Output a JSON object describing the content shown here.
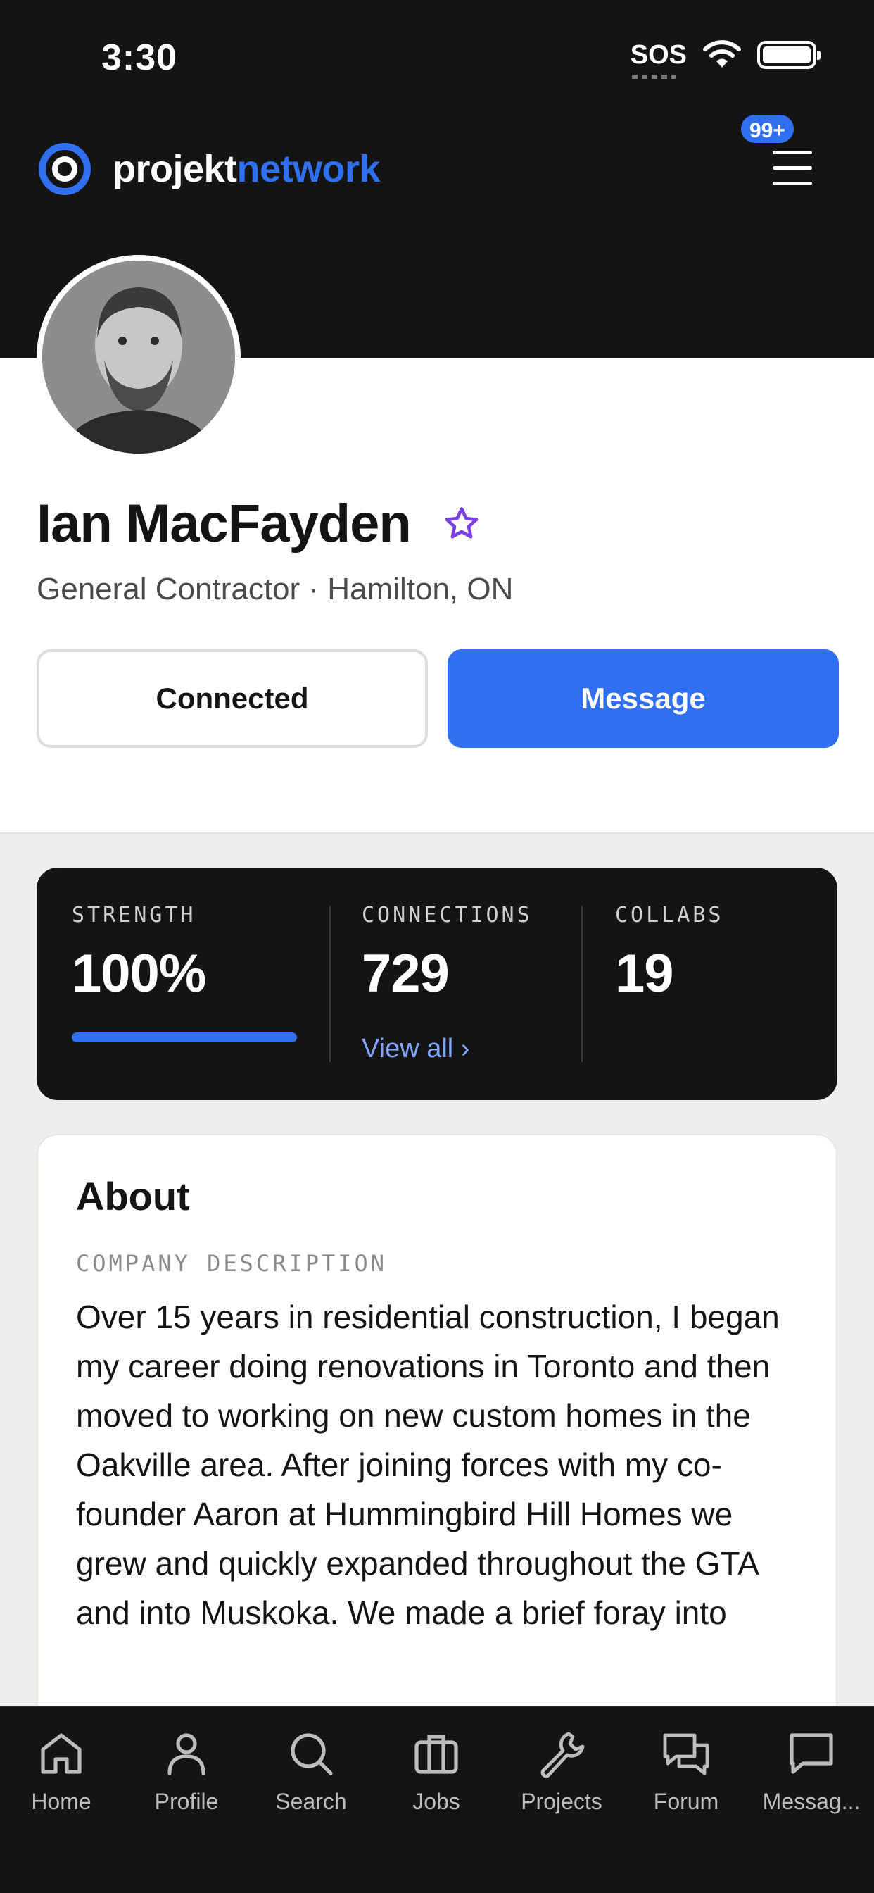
{
  "status_bar": {
    "time": "3:30",
    "sos": "SOS"
  },
  "header": {
    "logo_primary": "projekt",
    "logo_accent": "network",
    "notification_badge": "99+"
  },
  "profile": {
    "name": "Ian MacFayden",
    "subtitle": "General Contractor · Hamilton, ON",
    "connected_label": "Connected",
    "message_label": "Message"
  },
  "stats": {
    "strength_label": "STRENGTH",
    "strength_value": "100%",
    "strength_fraction": 1.0,
    "connections_label": "CONNECTIONS",
    "connections_value": "729",
    "view_all": "View all ›",
    "collabs_label": "COLLABS",
    "collabs_value": "19"
  },
  "about": {
    "title": "About",
    "label": "COMPANY DESCRIPTION",
    "text": "Over 15 years in residential construction, I began my career doing renovations in Toronto and then moved to working on new custom homes in the Oakville area. After joining forces with my co-founder Aaron at Hummingbird Hill Homes we grew and quickly expanded throughout the GTA and into Muskoka. We made a brief foray into"
  },
  "tabs": [
    {
      "label": "Home",
      "icon": "home-icon"
    },
    {
      "label": "Profile",
      "icon": "profile-icon"
    },
    {
      "label": "Search",
      "icon": "search-icon"
    },
    {
      "label": "Jobs",
      "icon": "briefcase-icon"
    },
    {
      "label": "Projects",
      "icon": "wrench-icon"
    },
    {
      "label": "Forum",
      "icon": "chat-bubbles-icon"
    },
    {
      "label": "Messag...",
      "icon": "message-icon"
    }
  ],
  "colors": {
    "accent": "#2f6ff0",
    "dark": "#141414",
    "star": "#7b3fe4"
  }
}
